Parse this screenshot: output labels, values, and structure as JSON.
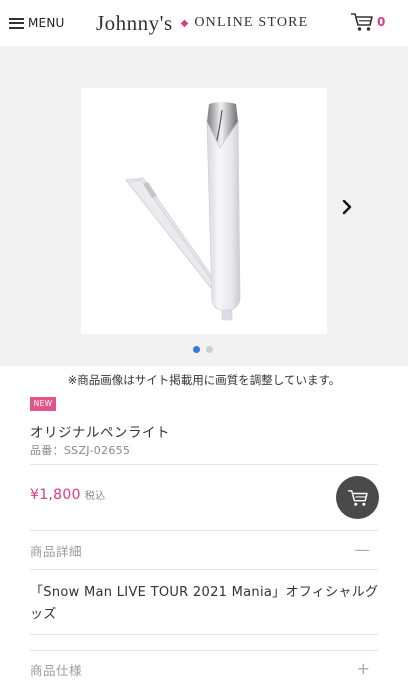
{
  "header": {
    "menu_label": "MENU",
    "logo_main": "Johnny's",
    "logo_dot": "◆",
    "logo_sub": "ONLINE STORE",
    "cart_count": "0"
  },
  "gallery": {
    "image_notice": "※商品画像はサイト掲載用に画質を調整しています。",
    "slide_count": 2,
    "active_slide": 1
  },
  "product": {
    "badge": "NEW",
    "name": "オリジナルペンライト",
    "code": "品番：SSZJ-02655",
    "price": "¥1,800",
    "tax_label": "税込"
  },
  "sections": {
    "details_title": "商品詳細",
    "details_toggle": "—",
    "description": "「Snow Man LIVE TOUR 2021 Mania」オフィシャルグッズ",
    "specs_title": "商品仕様",
    "specs_toggle": "+"
  },
  "colors": {
    "accent": "#d83b7f",
    "dot_active": "#2f7be0",
    "gallery_bg": "#f2f2f2",
    "cart_button": "#4a4a4a"
  }
}
